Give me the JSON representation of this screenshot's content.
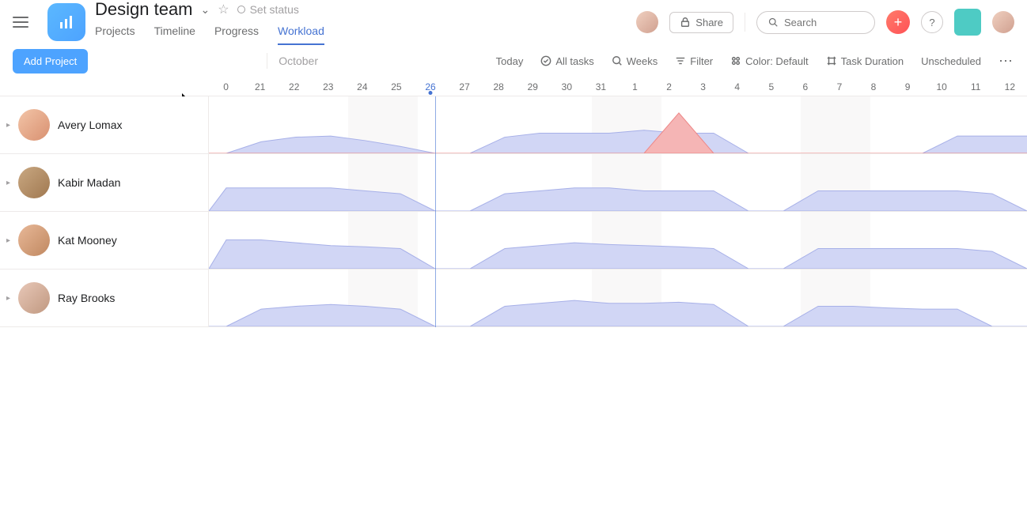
{
  "header": {
    "title": "Design team",
    "status_label": "Set status",
    "tabs": [
      "Projects",
      "Timeline",
      "Progress",
      "Workload"
    ],
    "active_tab": 3,
    "share_label": "Share",
    "search_placeholder": "Search"
  },
  "toolbar": {
    "add_project_label": "Add Project",
    "month_label": "October",
    "today_label": "Today",
    "all_tasks_label": "All tasks",
    "weeks_label": "Weeks",
    "filter_label": "Filter",
    "color_label": "Color: Default",
    "task_duration_label": "Task Duration",
    "unscheduled_label": "Unscheduled"
  },
  "dates": [
    "0",
    "21",
    "22",
    "23",
    "24",
    "25",
    "26",
    "27",
    "28",
    "29",
    "30",
    "31",
    "1",
    "2",
    "3",
    "4",
    "5",
    "6",
    "7",
    "8",
    "9",
    "10",
    "11",
    "12"
  ],
  "today_index": 6,
  "weekends": [
    [
      4,
      5
    ],
    [
      11,
      12
    ],
    [
      17,
      18
    ]
  ],
  "users": [
    {
      "name": "Avery Lomax"
    },
    {
      "name": "Kabir Madan"
    },
    {
      "name": "Kat Mooney"
    },
    {
      "name": "Ray Brooks"
    }
  ],
  "chart_data": [
    {
      "type": "area",
      "x": [
        20,
        21,
        22,
        23,
        24,
        25,
        26,
        27,
        28,
        29,
        30,
        31,
        1,
        2,
        3,
        4,
        5,
        6,
        7,
        8,
        9,
        10,
        11,
        12
      ],
      "series": [
        {
          "name": "Avery Lomax normal",
          "color": "#d1d6f5",
          "values": [
            0,
            20,
            28,
            30,
            22,
            12,
            0,
            0,
            28,
            35,
            35,
            35,
            40,
            35,
            35,
            0,
            0,
            0,
            0,
            0,
            0,
            30,
            30,
            30,
            0,
            0,
            35,
            35,
            35,
            0
          ]
        },
        {
          "name": "Avery Lomax overload",
          "color": "#f5b5b5",
          "values": [
            0,
            0,
            0,
            0,
            0,
            0,
            0,
            0,
            0,
            0,
            0,
            0,
            0,
            70,
            0,
            0,
            0,
            0,
            0,
            0,
            0,
            0,
            0,
            0
          ]
        }
      ]
    },
    {
      "type": "area",
      "x": [
        20,
        21,
        22,
        23,
        24,
        25,
        26,
        27,
        28,
        29,
        30,
        31,
        1,
        2,
        3,
        4,
        5,
        6,
        7,
        8,
        9,
        10,
        11,
        12
      ],
      "series": [
        {
          "name": "Kabir Madan",
          "color": "#d1d6f5",
          "values": [
            40,
            40,
            40,
            40,
            35,
            30,
            0,
            0,
            30,
            35,
            40,
            40,
            35,
            35,
            35,
            0,
            0,
            35,
            35,
            35,
            35,
            35,
            30,
            0,
            0,
            35,
            40,
            40,
            35,
            35
          ]
        }
      ]
    },
    {
      "type": "area",
      "x": [
        20,
        21,
        22,
        23,
        24,
        25,
        26,
        27,
        28,
        29,
        30,
        31,
        1,
        2,
        3,
        4,
        5,
        6,
        7,
        8,
        9,
        10,
        11,
        12
      ],
      "series": [
        {
          "name": "Kat Mooney",
          "color": "#d1d6f5",
          "values": [
            50,
            50,
            45,
            40,
            38,
            35,
            0,
            0,
            35,
            40,
            45,
            42,
            40,
            38,
            35,
            0,
            0,
            35,
            35,
            35,
            35,
            35,
            30,
            0,
            0,
            35,
            35,
            35,
            35,
            35
          ]
        }
      ]
    },
    {
      "type": "area",
      "x": [
        20,
        21,
        22,
        23,
        24,
        25,
        26,
        27,
        28,
        29,
        30,
        31,
        1,
        2,
        3,
        4,
        5,
        6,
        7,
        8,
        9,
        10,
        11,
        12
      ],
      "series": [
        {
          "name": "Ray Brooks",
          "color": "#d1d6f5",
          "values": [
            0,
            30,
            35,
            38,
            35,
            30,
            0,
            0,
            35,
            40,
            45,
            40,
            40,
            42,
            38,
            0,
            0,
            35,
            35,
            32,
            30,
            30,
            0,
            0,
            0,
            0,
            0,
            0,
            0,
            0
          ]
        }
      ]
    }
  ]
}
